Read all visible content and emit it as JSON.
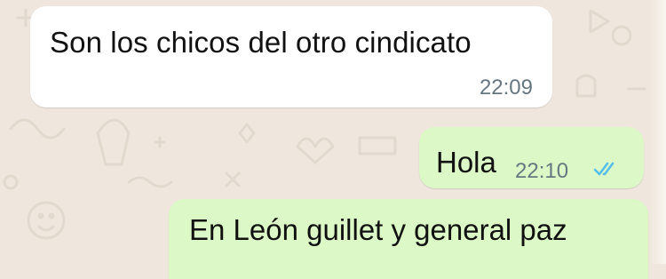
{
  "chat": {
    "messages": [
      {
        "direction": "incoming",
        "text": "Son los chicos del otro cindicato",
        "time": "22:09"
      },
      {
        "direction": "outgoing",
        "text": "Hola",
        "time": "22:10",
        "status_icon": "double-check-read-icon"
      },
      {
        "direction": "outgoing",
        "text": "En León guillet y general paz"
      }
    ]
  },
  "colors": {
    "background": "#efe7dd",
    "incoming_bubble": "#ffffff",
    "outgoing_bubble": "#dcf8c6",
    "timestamp": "#667781",
    "read_ticks": "#53bdeb"
  }
}
